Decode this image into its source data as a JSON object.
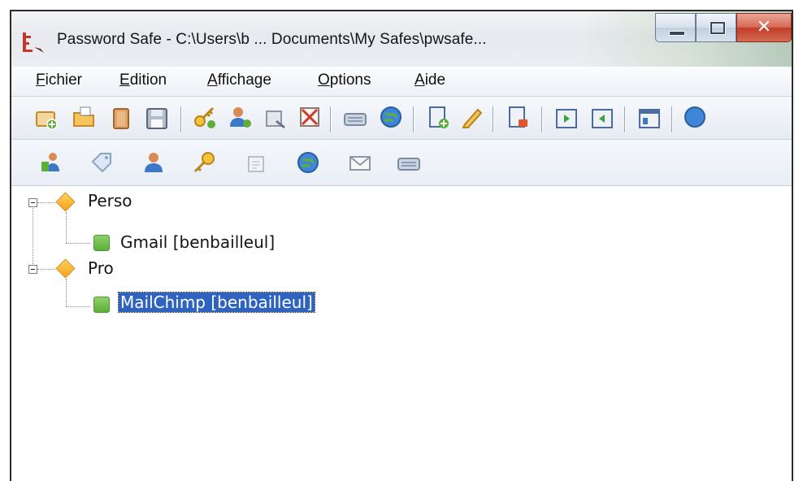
{
  "window": {
    "title": "Password Safe - C:\\Users\\b ... Documents\\My Safes\\pwsafe...",
    "controls": {
      "minimize": "–",
      "maximize": "□",
      "close": "✕"
    }
  },
  "menubar": {
    "items": [
      {
        "label": "Fichier"
      },
      {
        "label": "Edition"
      },
      {
        "label": "Affichage"
      },
      {
        "label": "Options"
      },
      {
        "label": "Aide"
      }
    ]
  },
  "toolbar_main": {
    "icons": [
      "new-database-icon",
      "open-database-icon",
      "close-database-icon",
      "save-icon",
      "copy-password-icon",
      "copy-username-icon",
      "copy-notes-icon",
      "clear-clipboard-icon",
      "autotype-icon",
      "browse-url-icon",
      "add-entry-icon",
      "edit-entry-icon",
      "delete-entry-icon",
      "expand-all-icon",
      "collapse-all-icon",
      "options-icon",
      "help-icon"
    ]
  },
  "toolbar_secondary": {
    "icons": [
      "copy-username-icon",
      "tag-icon",
      "user-icon",
      "key-icon",
      "notes-icon",
      "globe-icon",
      "email-icon",
      "run-command-icon"
    ]
  },
  "tree": {
    "groups": [
      {
        "label": "Perso",
        "entries": [
          {
            "label": "Gmail [benbailleul]",
            "selected": false
          }
        ]
      },
      {
        "label": "Pro",
        "entries": [
          {
            "label": "MailChimp [benbailleul]",
            "selected": true
          }
        ]
      }
    ]
  },
  "colors": {
    "selection": "#2f63c0",
    "group_icon": "#f4a21a",
    "entry_icon": "#5daf38",
    "close_button": "#c33d27"
  }
}
